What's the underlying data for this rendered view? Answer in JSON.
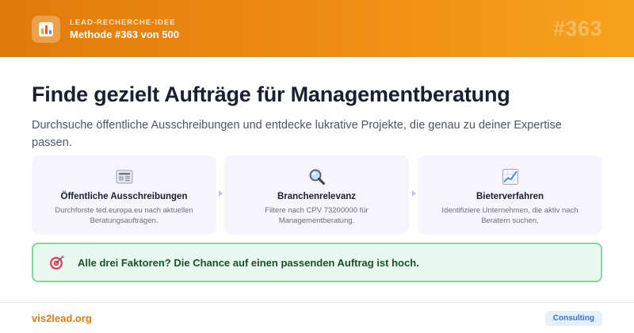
{
  "header": {
    "kicker": "LEAD-RECHERCHE-IDEE",
    "subtitle": "Methode #363 von 500",
    "watermark": "#363",
    "icon": "bar-chart-icon"
  },
  "main": {
    "headline": "Finde gezielt Aufträge für Managementberatung",
    "description": "Durchsuche öffentliche Ausschreibungen und entdecke lukrative Projekte, die genau zu deiner Expertise passen.",
    "cards": [
      {
        "icon": "newspaper-icon",
        "title": "Öffentliche Ausschreibungen",
        "text": "Durchforste ted.europa.eu nach aktuellen Beratungsaufträgen."
      },
      {
        "icon": "magnifier-icon",
        "title": "Branchenrelevanz",
        "text": "Filtere nach CPV 73200000 für Managementberatung."
      },
      {
        "icon": "trend-chart-icon",
        "title": "Bieterverfahren",
        "text": "Identifiziere Unternehmen, die aktiv nach Beratern suchen."
      }
    ],
    "callout": {
      "icon": "target-icon",
      "text": "Alle drei Faktoren? Die Chance auf einen passenden Auftrag ist hoch."
    }
  },
  "footer": {
    "site": "vis2lead.org",
    "tag": "Consulting"
  },
  "colors": {
    "header_start": "#e07b0a",
    "header_end": "#f6a21e",
    "accent": "#e07b0a",
    "card_bg": "#f6f4fc",
    "callout_bg": "#e9f8ef",
    "callout_border": "#7fd6a2",
    "callout_text": "#14532d",
    "tag_text": "#3a6fcf"
  }
}
